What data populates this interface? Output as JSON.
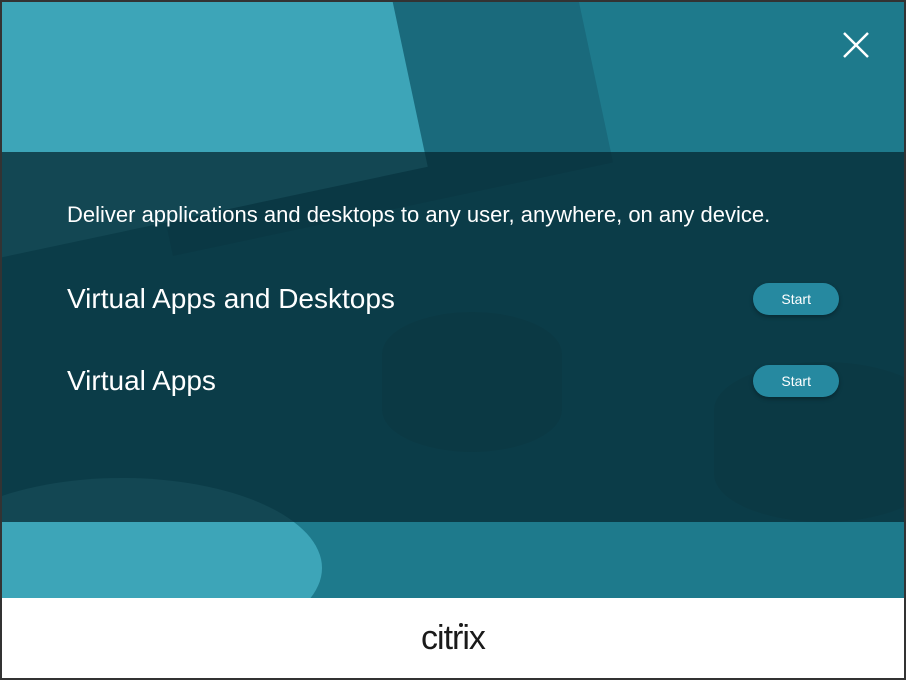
{
  "headline": "Deliver applications and desktops to any user, anywhere, on any device.",
  "options": [
    {
      "label": "Virtual Apps and Desktops",
      "button": "Start"
    },
    {
      "label": "Virtual Apps",
      "button": "Start"
    }
  ],
  "footer": {
    "brand": "citrix"
  },
  "colors": {
    "primary_bg": "#1e7a8c",
    "accent": "#3da5b8",
    "panel": "rgba(5,40,50,0.75)",
    "button": "#2689a0"
  }
}
